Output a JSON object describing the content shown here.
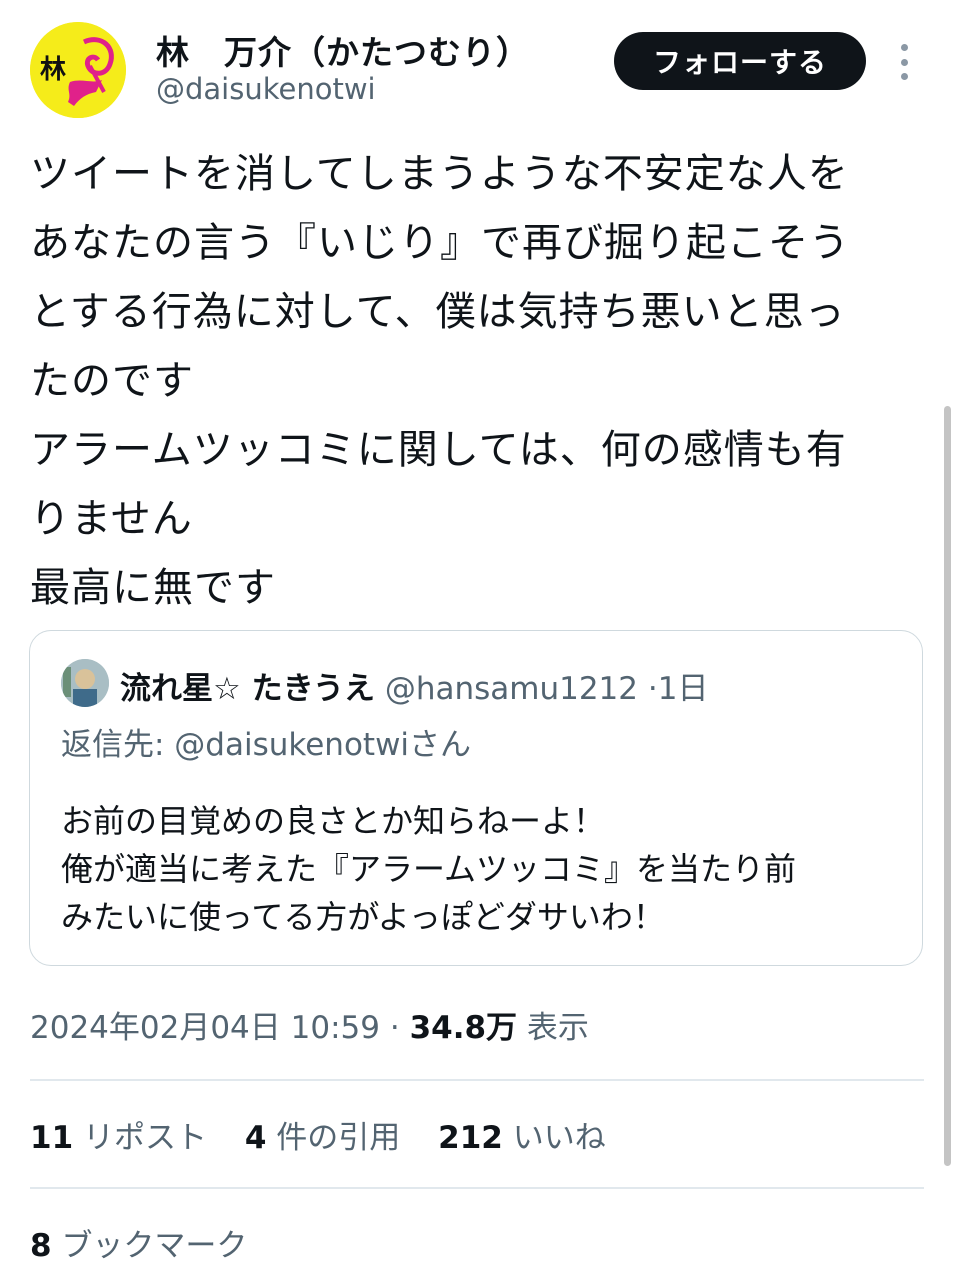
{
  "author": {
    "display_name": "林　万介（かたつむり）",
    "handle": "@daisukenotwi",
    "avatar_text": "林",
    "avatar_bg": "#f5ec1a"
  },
  "actions": {
    "follow_label": "フォローする",
    "more_icon": "more-vertical-icon"
  },
  "tweet": {
    "lines": [
      "ツイートを消してしまうような不安定な人を",
      "あなたの言う『いじり』で再び掘り起こそう",
      "とする行為に対して、僕は気持ち悪いと思っ",
      "たのです",
      "アラームツッコミに関しては、何の感情も有",
      "りません",
      "最高に無です"
    ]
  },
  "quote": {
    "name": "流れ星☆ たきうえ",
    "handle": "@hansamu1212",
    "separator": "·",
    "time": "1日",
    "reply_to": "返信先: @daisukenotwiさん",
    "lines": [
      "お前の目覚めの良さとか知らねーよ！",
      "俺が適当に考えた『アラームツッコミ』を当たり前",
      "みたいに使ってる方がよっぽどダサいわ！"
    ]
  },
  "meta": {
    "timestamp": "2024年02月04日 10:59",
    "separator": "·",
    "views": "34.8万",
    "views_label": "表示"
  },
  "stats": {
    "reposts": "11",
    "reposts_label": "リポスト",
    "quotes": "4",
    "quotes_label": "件の引用",
    "likes": "212",
    "likes_label": "いいね",
    "bookmarks": "8",
    "bookmarks_label": "ブックマーク"
  },
  "colors": {
    "text": "#0f1419",
    "secondary": "#536471",
    "border": "#cfd9de",
    "button_bg": "#0f1419"
  }
}
